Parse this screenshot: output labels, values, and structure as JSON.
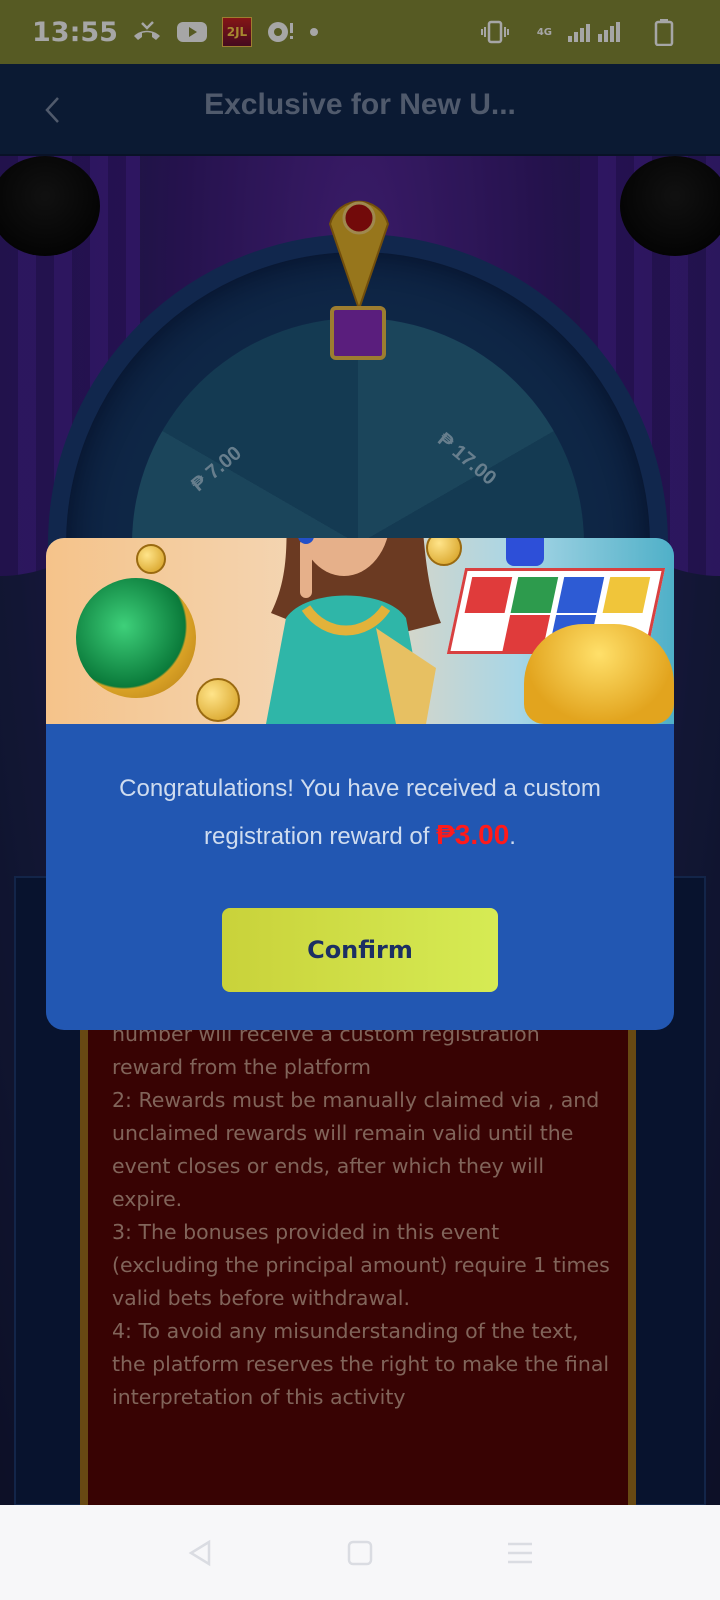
{
  "status_bar": {
    "time": "13:55",
    "app_badge": "2JL",
    "network": "4G"
  },
  "header": {
    "title": "Exclusive for New U..."
  },
  "wheel": {
    "left_value": "₱ 7.00",
    "right_value": "₱ 17.00"
  },
  "modal": {
    "message_before": "Congratulations! You have received a custom registration reward of ",
    "reward_amount": "₱3.00",
    "message_after": ".",
    "confirm_label": "Confirm"
  },
  "rules": {
    "lines": [
      "number will receive a custom registration reward from the platform",
      "2: Rewards must be manually claimed via , and unclaimed rewards will remain valid until the event closes or ends, after which they will expire.",
      "3: The bonuses provided in this event (excluding the principal amount) require 1 times valid bets before withdrawal.",
      "4: To avoid any misunderstanding of the text, the platform reserves the right to make the final interpretation of this activity"
    ]
  },
  "colors": {
    "status_bar": "#858a37",
    "header": "#12294f",
    "modal": "#2257b2",
    "reward": "#ff1a1a",
    "confirm": "#d0e048",
    "rules_panel": "#560606"
  }
}
